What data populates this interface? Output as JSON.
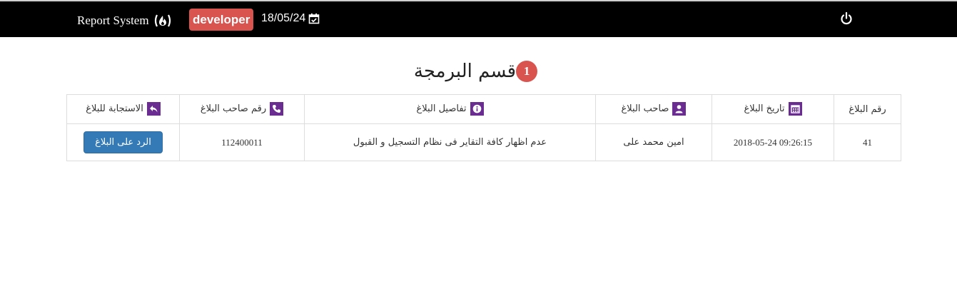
{
  "header": {
    "brand": "Report System",
    "role_badge": "developer",
    "date": "18/05/24",
    "colors": {
      "bar": "#000000",
      "badge": "#d9534f"
    }
  },
  "section": {
    "title": "قسم البرمجة",
    "count": "1"
  },
  "table": {
    "columns": [
      {
        "label": "رقم البلاغ",
        "icon": ""
      },
      {
        "label": "تاريخ البلاغ",
        "icon": "calendar-icon"
      },
      {
        "label": "صاحب البلاغ",
        "icon": "user-icon"
      },
      {
        "label": "تفاصيل البلاغ",
        "icon": "info-icon"
      },
      {
        "label": "رقم صاحب البلاغ",
        "icon": "phone-icon"
      },
      {
        "label": "الاستجابة للبلاغ",
        "icon": "reply-icon"
      }
    ],
    "rows": [
      {
        "id": "41",
        "date": "2018-05-24 09:26:15",
        "owner": "امين محمد على",
        "details": "عدم اظهار كافة التقاير فى نظام التسجيل و القبول",
        "phone": "112400011",
        "action": "الرد على البلاغ"
      }
    ],
    "icon_color": "#6b2c91",
    "button_color": "#337ab7"
  }
}
